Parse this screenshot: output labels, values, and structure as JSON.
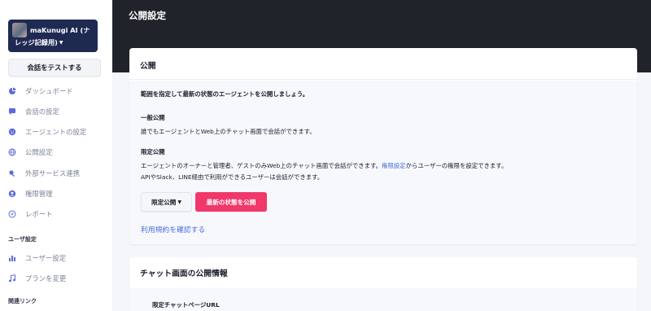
{
  "sidebar": {
    "agent_name_line1": "maKunugi AI (ナ",
    "agent_name_line2": "レッジ記録用)",
    "test_button": "会話をテストする",
    "items": [
      {
        "label": "ダッシュボード",
        "icon": "pie-chart-icon"
      },
      {
        "label": "会話の設定",
        "icon": "chat-bubble-icon"
      },
      {
        "label": "エージェントの設定",
        "icon": "smiley-icon"
      },
      {
        "label": "公開設定",
        "icon": "globe-icon"
      },
      {
        "label": "外部サービス連携",
        "icon": "plug-icon"
      },
      {
        "label": "権限管理",
        "icon": "user-circle-icon"
      },
      {
        "label": "レポート",
        "icon": "compass-icon"
      }
    ],
    "user_section_label": "ユーザ設定",
    "user_items": [
      {
        "label": "ユーザー設定",
        "icon": "bar-chart-icon"
      },
      {
        "label": "プランを変更",
        "icon": "music-icon"
      }
    ],
    "related_section_label": "関連リンク"
  },
  "header": {
    "title": "公開設定"
  },
  "publish_card": {
    "title": "公開",
    "intro": "範囲を指定して最新の状態のエージェントを公開しましょう。",
    "general_heading": "一般公開",
    "general_desc": "誰でもエージェントとWeb上のチャット画面で会話ができます。",
    "limited_heading": "限定公開",
    "limited_desc_pre": "エージェントのオーナーと管理者、ゲストのみWeb上のチャット画面で会話ができます。",
    "limited_desc_link": "権限設定",
    "limited_desc_post": "からユーザーの権限を設定できます。",
    "limited_desc2": "APIやSlack、LINE経由で利用ができるユーザーは会話ができます。",
    "scope_select": "限定公開",
    "publish_button": "最新の状態を公開",
    "terms_link": "利用規約を確認する"
  },
  "chat_card": {
    "title": "チャット画面の公開情報",
    "sub_heading": "限定チャットページURL"
  },
  "colors": {
    "accent_pink": "#f0386b",
    "link_blue": "#4a6cdc",
    "agent_card": "#1f2a52",
    "header_dark": "#21232b"
  }
}
